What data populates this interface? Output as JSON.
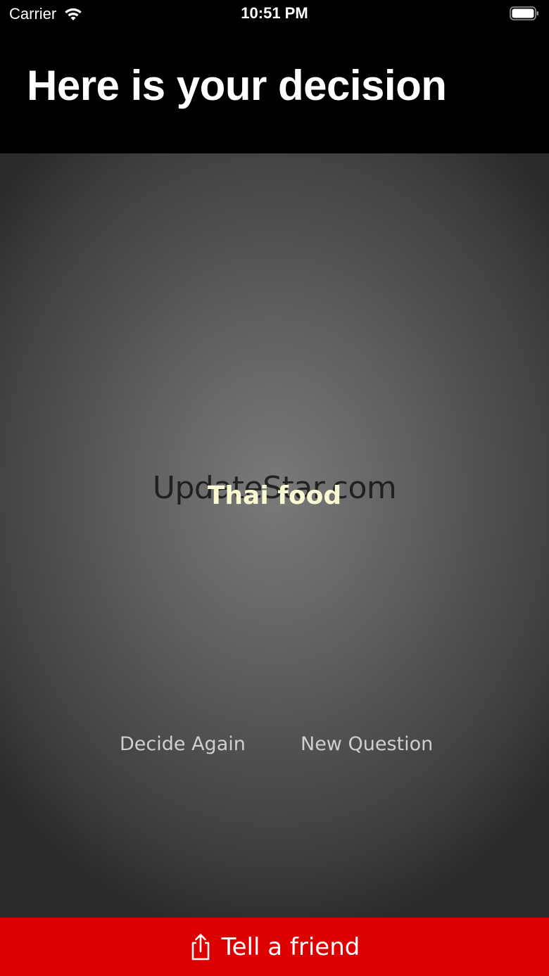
{
  "status_bar": {
    "carrier": "Carrier",
    "time": "10:51 PM"
  },
  "header": {
    "title": "Here is your decision"
  },
  "main": {
    "watermark": "UpdateStar.com",
    "decision": "Thai food",
    "decide_again_label": "Decide Again",
    "new_question_label": "New Question"
  },
  "footer": {
    "share_label": "Tell a friend",
    "share_icon": "share-icon"
  },
  "colors": {
    "share_bar": "#dd0000",
    "decision_text": "#fafad2",
    "header_bg": "#000000"
  }
}
